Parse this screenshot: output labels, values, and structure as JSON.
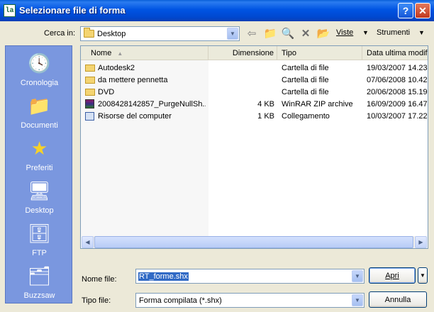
{
  "window": {
    "title": "Selezionare file di forma",
    "icon_text": "la",
    "help_label": "?",
    "close_label": "✕"
  },
  "lookin": {
    "label": "Cerca in:",
    "value": "Desktop"
  },
  "toolbar": {
    "back_icon": "⇦",
    "up_icon": "📁",
    "search_icon": "🔍",
    "delete_icon": "✕",
    "newfolder_icon": "📂",
    "views_label": "Viste",
    "tools_label": "Strumenti"
  },
  "places": [
    {
      "label": "Cronologia",
      "icon": "🕓"
    },
    {
      "label": "Documenti",
      "icon": "📁"
    },
    {
      "label": "Preferiti",
      "icon": "★"
    },
    {
      "label": "Desktop",
      "icon": "🖥"
    },
    {
      "label": "FTP",
      "icon": "🗄"
    },
    {
      "label": "Buzzsaw",
      "icon": "🗂"
    }
  ],
  "columns": {
    "name": "Nome",
    "size": "Dimensione",
    "type": "Tipo",
    "modified": "Data ultima modifi"
  },
  "files": [
    {
      "name": "Autodesk2",
      "size": "",
      "type": "Cartella di file",
      "modified": "19/03/2007 14.23",
      "kind": "folder"
    },
    {
      "name": "da mettere pennetta",
      "size": "",
      "type": "Cartella di file",
      "modified": "07/06/2008 10.42",
      "kind": "folder"
    },
    {
      "name": "DVD",
      "size": "",
      "type": "Cartella di file",
      "modified": "20/06/2008 15.19",
      "kind": "folder"
    },
    {
      "name": "2008428142857_PurgeNullSh...",
      "size": "4 KB",
      "type": "WinRAR ZIP archive",
      "modified": "16/09/2009 16.47",
      "kind": "rar"
    },
    {
      "name": "Risorse del computer",
      "size": "1 KB",
      "type": "Collegamento",
      "modified": "10/03/2007 17.22",
      "kind": "lnk"
    }
  ],
  "filename": {
    "label": "Nome file:",
    "value": "RT_forme.shx"
  },
  "filetype": {
    "label": "Tipo file:",
    "value": "Forma compilata (*.shx)"
  },
  "buttons": {
    "open": "Apri",
    "cancel": "Annulla"
  },
  "colors": {
    "titlebar": "#0054e3",
    "places_bg": "#7a97df",
    "selection": "#316ac5",
    "dialog_bg": "#ece9d8"
  }
}
